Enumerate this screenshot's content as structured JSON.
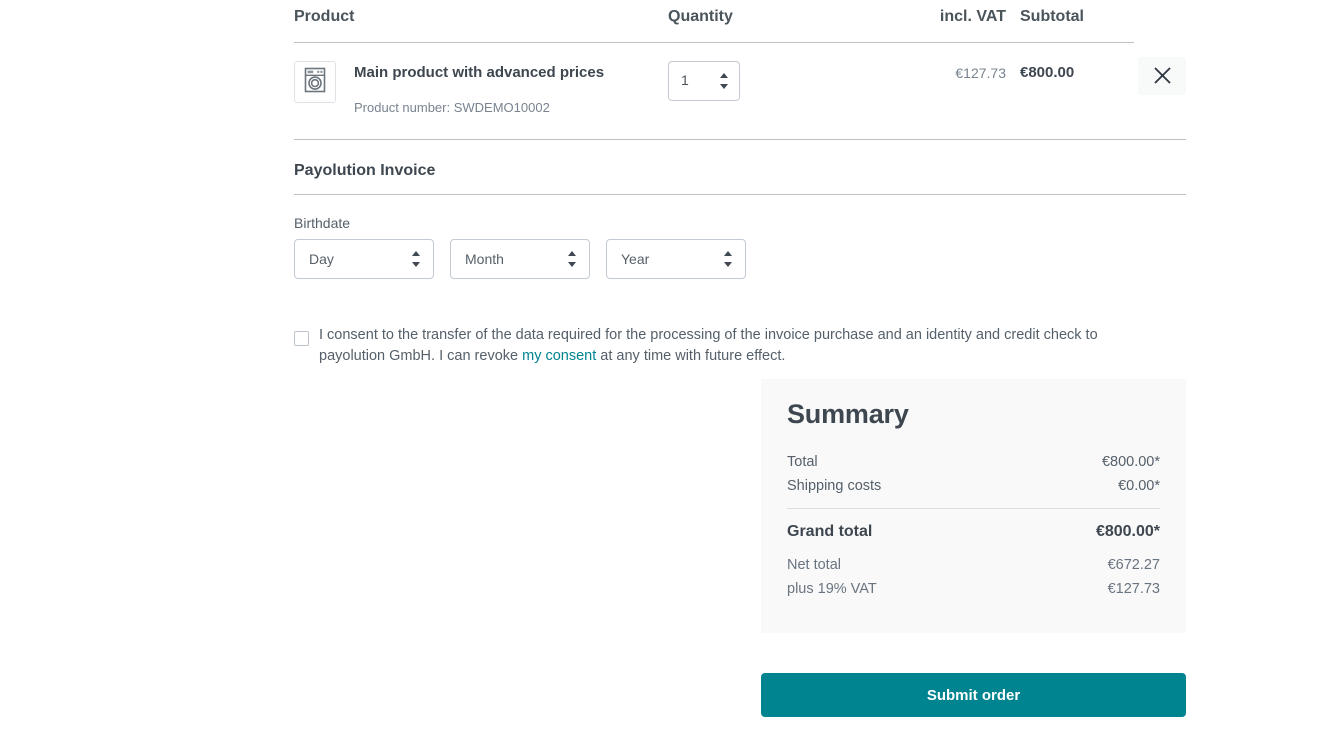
{
  "cart": {
    "columns": {
      "product": "Product",
      "quantity": "Quantity",
      "vat": "incl. VAT",
      "subtotal": "Subtotal"
    },
    "items": [
      {
        "name": "Main product with advanced prices",
        "product_number_label": "Product number: SWDEMO10002",
        "quantity": "1",
        "vat": "€127.73",
        "subtotal": "€800.00",
        "thumbnail_icon": "washing-machine-icon",
        "remove_icon": "close-icon"
      }
    ]
  },
  "payment": {
    "title": "Payolution Invoice",
    "birthdate_label": "Birthdate",
    "selects": [
      {
        "name": "day",
        "value": "Day"
      },
      {
        "name": "month",
        "value": "Month"
      },
      {
        "name": "year",
        "value": "Year"
      }
    ]
  },
  "consent": {
    "text_before": "I consent to the transfer of the data required for the processing of the invoice purchase and an identity and credit check to payolution GmbH. I can revoke ",
    "link_text": "my consent",
    "text_after": " at any time with future effect.",
    "checked": false
  },
  "summary": {
    "title": "Summary",
    "rows": [
      {
        "label": "Total",
        "value": "€800.00*"
      },
      {
        "label": "Shipping costs",
        "value": "€0.00*"
      }
    ],
    "grand_total": {
      "label": "Grand total",
      "value": "€800.00*"
    },
    "tax_rows": [
      {
        "label": "Net total",
        "value": "€672.27"
      },
      {
        "label": "plus 19% VAT",
        "value": "€127.73"
      }
    ]
  },
  "actions": {
    "submit_label": "Submit order"
  },
  "colors": {
    "accent": "#008490",
    "text": "#4a545b",
    "muted": "#798490",
    "panel_bg": "#f9f9f9",
    "border": "#bcc1c7"
  }
}
